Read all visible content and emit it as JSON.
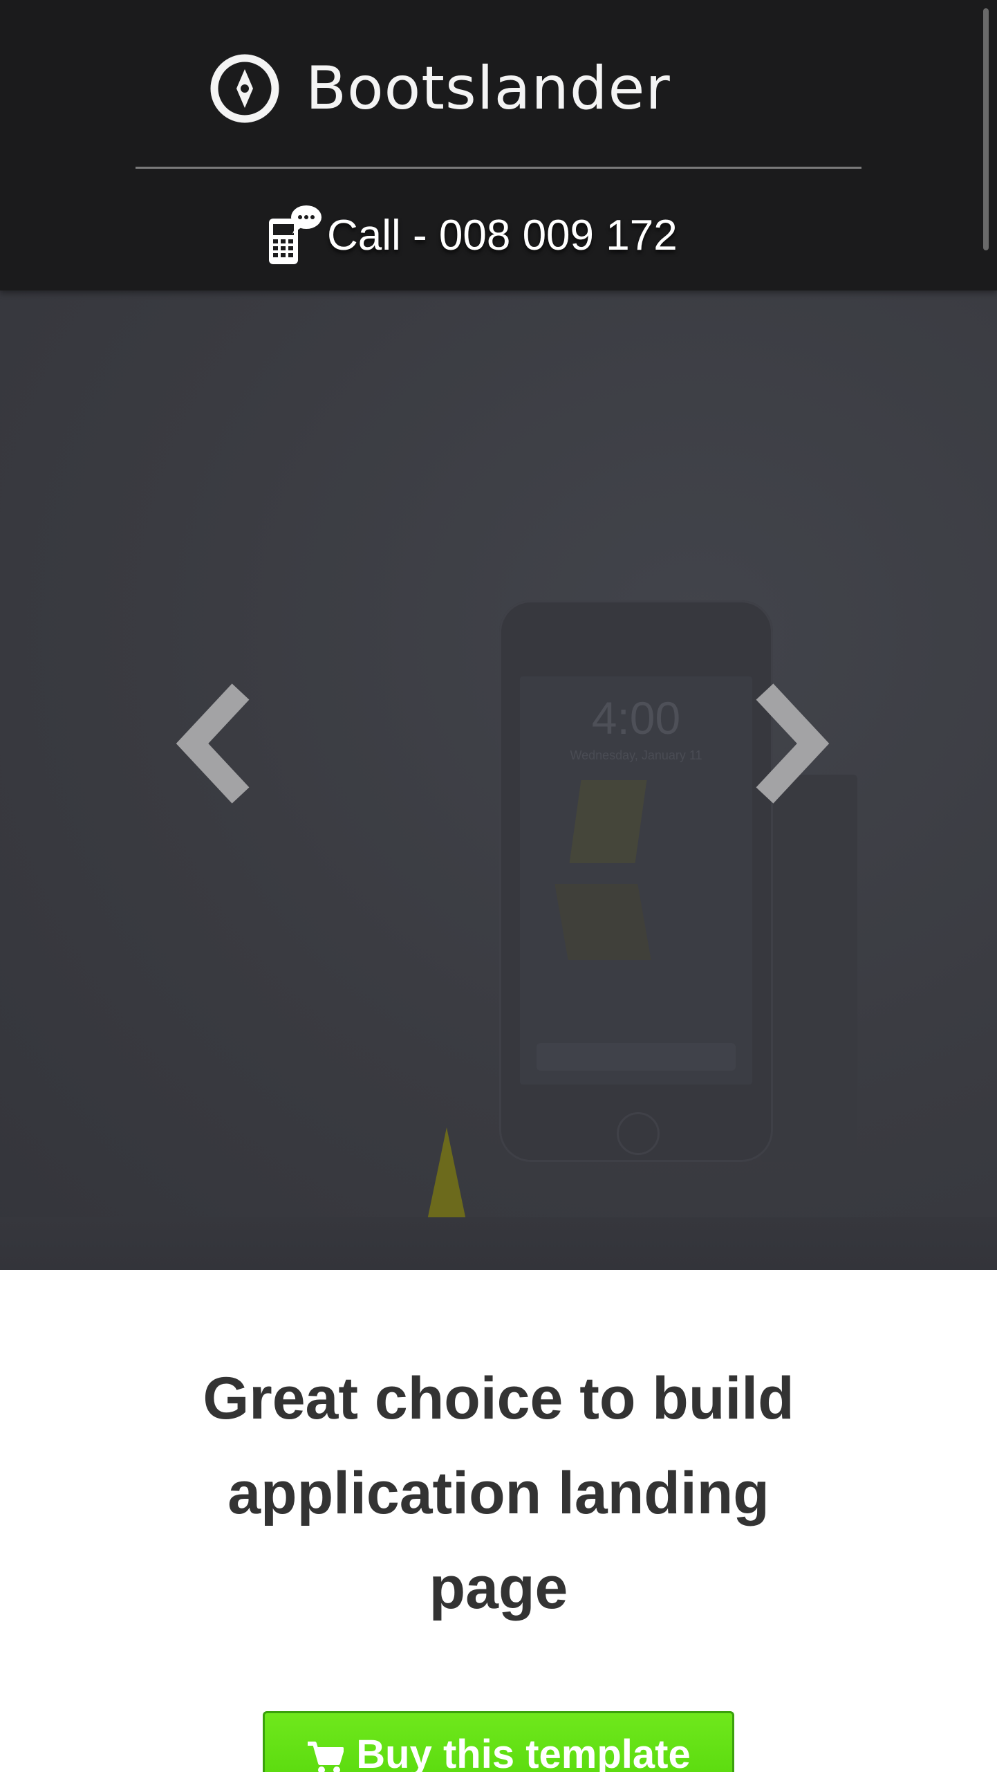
{
  "header": {
    "brand": "Bootslander",
    "brand_icon": "compass-logo-icon",
    "call_icon": "mobile-phone-chat-icon",
    "call_text": "Call - 008 009 172"
  },
  "hero": {
    "prev_icon": "chevron-left-icon",
    "next_icon": "chevron-right-icon",
    "device_clock": "4:00",
    "device_date": "Wednesday, January 11"
  },
  "content": {
    "tagline": "Great choice to build application landing page",
    "buy_button_label": "Buy this template",
    "buy_button_icon": "shopping-cart-icon"
  },
  "colors": {
    "header_bg": "#1b1b1c",
    "hero_bg": "#3a3b41",
    "button_green": "#5ee014",
    "heading_text": "#333333"
  }
}
